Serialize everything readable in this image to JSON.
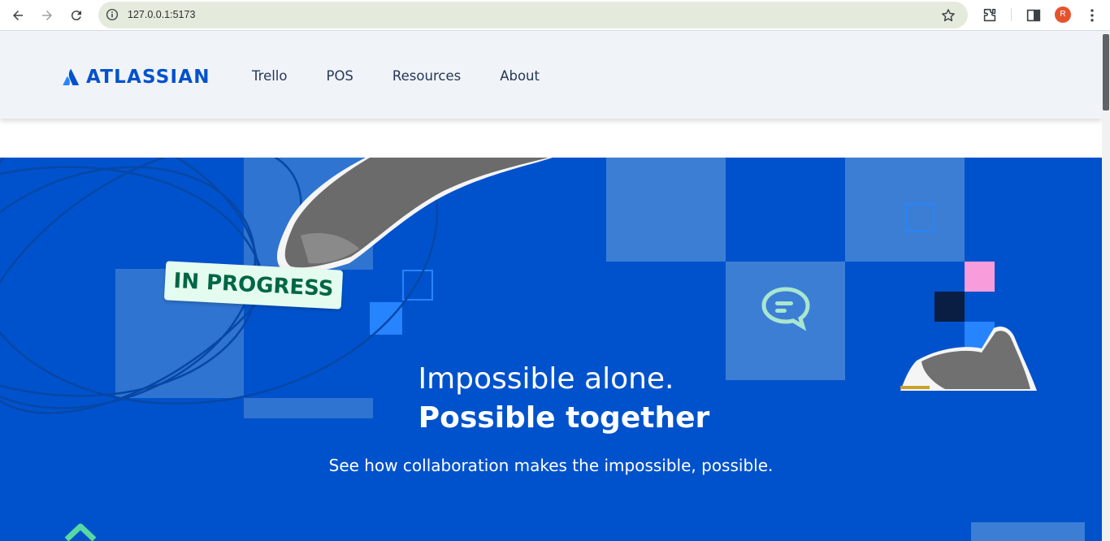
{
  "browser": {
    "url": "127.0.0.1:5173",
    "profile_initial": "R",
    "icons": [
      "back-arrow-icon",
      "forward-arrow-icon",
      "reload-icon",
      "site-info-icon",
      "bookmark-star-icon",
      "extensions-puzzle-icon",
      "side-panel-icon",
      "kebab-menu-icon"
    ]
  },
  "header": {
    "logo_text": "ATLASSIAN",
    "nav": [
      {
        "label": "Trello"
      },
      {
        "label": "POS"
      },
      {
        "label": "Resources"
      },
      {
        "label": "About"
      }
    ]
  },
  "hero": {
    "tag_text": "IN PROGRESS",
    "headline_line1": "Impossible alone.",
    "headline_line2": "Possible together",
    "subtitle": "See how collaboration makes the impossible, possible."
  },
  "colors": {
    "brand_blue": "#0052cc",
    "light_tile": "#4c9aff",
    "header_bg": "#f0f3f7",
    "tag_bg": "#e3fcef",
    "tag_text": "#006644",
    "pink": "#f99cdb"
  }
}
